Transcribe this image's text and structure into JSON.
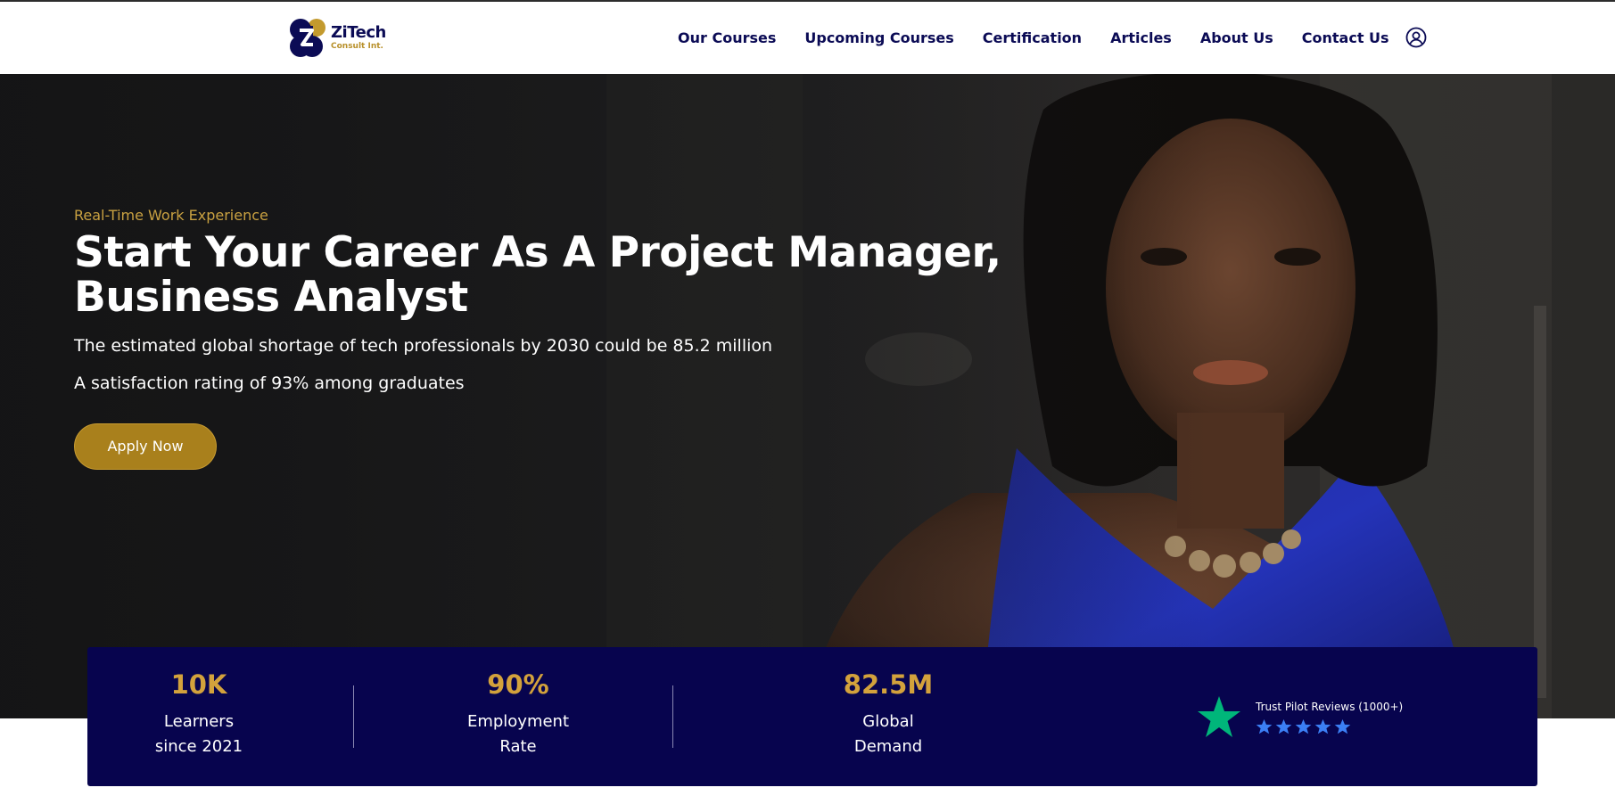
{
  "brand": {
    "name": "ZiTech",
    "sub": "Consult Int."
  },
  "nav": {
    "items": [
      {
        "label": "Our Courses"
      },
      {
        "label": "Upcoming Courses"
      },
      {
        "label": "Certification"
      },
      {
        "label": "Articles"
      },
      {
        "label": "About Us"
      },
      {
        "label": "Contact Us"
      }
    ],
    "account_icon": "user-circle-icon"
  },
  "hero": {
    "eyebrow": "Real-Time Work Experience",
    "title": "Start Your Career As A Project Manager, Business Analyst",
    "line1": "The estimated global shortage of tech professionals by 2030 could be 85.2 million",
    "line2": "A satisfaction rating of 93% among graduates",
    "cta": "Apply Now"
  },
  "stats": [
    {
      "value": "10K",
      "label1": "Learners",
      "label2": "since 2021"
    },
    {
      "value": "90%",
      "label1": "Employment",
      "label2": "Rate"
    },
    {
      "value": "82.5M",
      "label1": "Global",
      "label2": "Demand"
    }
  ],
  "trust": {
    "label": "Trust Pilot Reviews (1000+)",
    "rating": 5,
    "icon": "trustpilot-star-icon"
  },
  "colors": {
    "navy": "#07044e",
    "gold": "#d3a23c",
    "button": "#a9801c",
    "trust_green": "#00b67a",
    "trust_blue": "#3b7ff5"
  }
}
